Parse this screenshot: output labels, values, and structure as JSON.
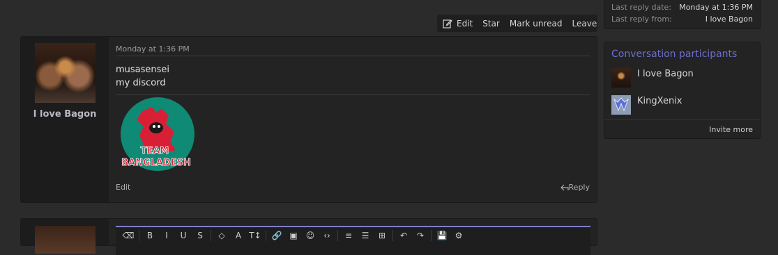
{
  "toolbar": {
    "edit_icon": "edit-icon",
    "edit_label": "Edit",
    "star_label": "Star",
    "mark_unread_label": "Mark unread",
    "leave_label": "Leave"
  },
  "message": {
    "date": "Monday at 1:36 PM",
    "author": "I love Bagon",
    "lines": [
      "musasensei",
      "my discord"
    ],
    "image_alt_icon": "team-bangladesh-logo",
    "image_logo_text_top": "TEAM",
    "image_logo_text_bottom": "BANGLADESH",
    "edit_label": "Edit",
    "reply_label": "Reply"
  },
  "thread_info": {
    "last_reply_date_label": "Last reply date:",
    "last_reply_date_value": "Monday at 1:36 PM",
    "last_reply_from_label": "Last reply from:",
    "last_reply_from_value": "I love Bagon"
  },
  "participants": {
    "title": "Conversation participants",
    "items": [
      {
        "name": "I love Bagon"
      },
      {
        "name": "KingXenix"
      }
    ],
    "invite_label": "Invite more"
  },
  "editor": {
    "toolbar_items": [
      "⌫",
      "B",
      "I",
      "U",
      "S",
      "◇",
      "A",
      "T↕",
      "🔗",
      "▣",
      "☺",
      "‹›",
      "≡",
      "☰",
      "⊞",
      "↶",
      "↷",
      "💾",
      "⚙"
    ]
  },
  "colors": {
    "accent": "#6e6ecf",
    "background": "#2b2b2b",
    "panel": "#232323"
  }
}
